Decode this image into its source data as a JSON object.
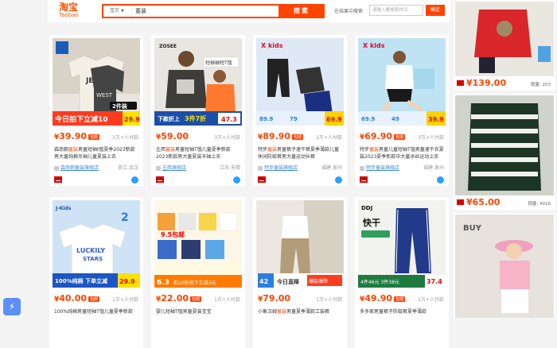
{
  "header": {
    "logo_cn": "淘宝",
    "logo_en": "Taobao",
    "search_category": "宝贝",
    "search_value": "童装",
    "search_button": "搜索",
    "within_label": "在结果中搜索",
    "within_placeholder": "请输入要搜索的词",
    "within_button": "确定"
  },
  "products": [
    {
      "price": "39.90",
      "sales": "3万+人付款",
      "title_pre": "森南朝",
      "title_hl": "童装",
      "title_post": "男童短袖t恤夏季2023新款男大童纯棉半袖儿童夏装上衣",
      "shop": "森南朝童装旗舰店",
      "location": "浙江 武汉",
      "badge": "今日拍下立减10",
      "badge_price": "29.9"
    },
    {
      "price": "59.00",
      "sales": "3万+人付款",
      "title_pre": "左西",
      "title_hl": "童装",
      "title_post": "男童短袖T恤儿童夏季新款2023新款男大童夏装半袖上衣",
      "shop": "左西旗舰店",
      "location": "江苏 无锡",
      "badge": "下款折上",
      "badge_price": "47"
    },
    {
      "price": "89.90",
      "sales": "2万+人付款",
      "title_pre": "特步",
      "title_hl": "童装",
      "title_post": "男童裤子速干裤夏季薄款儿童休闲防蚊裤男大童运动长裤",
      "shop": "特步童装旗舰店",
      "location": "福建 泉州",
      "badge": "",
      "badge_price": "69"
    },
    {
      "price": "69.90",
      "sales": "3万+人付款",
      "title_pre": "特步",
      "title_hl": "童装",
      "title_post": "男童儿童短袖T恤男童速干衣夏装2023夏季新款中大童冰丝运动上衣",
      "shop": "特步童装旗舰店",
      "location": "福建 泉州",
      "badge": "",
      "badge_price": "39"
    },
    {
      "price": "40.00",
      "sales": "1万+人付款",
      "title_pre": "",
      "title_hl": "",
      "title_post": "100%纯棉男童短袖T恤儿童夏季新款",
      "shop": "",
      "location": "",
      "badge": "100%纯棉 下单立减",
      "badge_price": "29.9"
    },
    {
      "price": "22.00",
      "sales": "1万+人付款",
      "title_pre": "婴儿短袖T恤男童夏装宝宝",
      "title_hl": "",
      "title_post": "",
      "shop": "",
      "location": "",
      "badge": "",
      "badge_price": "6.3"
    },
    {
      "price": "79.00",
      "sales": "1万+人付款",
      "title_pre": "小象汉姆",
      "title_hl": "童装",
      "title_post": "男童夏季薄款工装裤",
      "shop": "",
      "location": "",
      "badge": "今日直降",
      "badge_price": "42"
    },
    {
      "price": "49.90",
      "sales": "1万+人付款",
      "title_pre": "多多家男童裤子防蚊裤夏季薄款",
      "title_hl": "",
      "title_post": "",
      "shop": "",
      "location": "",
      "badge": "快干",
      "badge_price": "37.4"
    }
  ],
  "side": [
    {
      "price": "139.00",
      "sales": "销量: 203"
    },
    {
      "price": "65.00",
      "sales": "销量: 4016"
    }
  ],
  "colors": {
    "accent": "#ff4400",
    "link": "#3d8ad8"
  }
}
